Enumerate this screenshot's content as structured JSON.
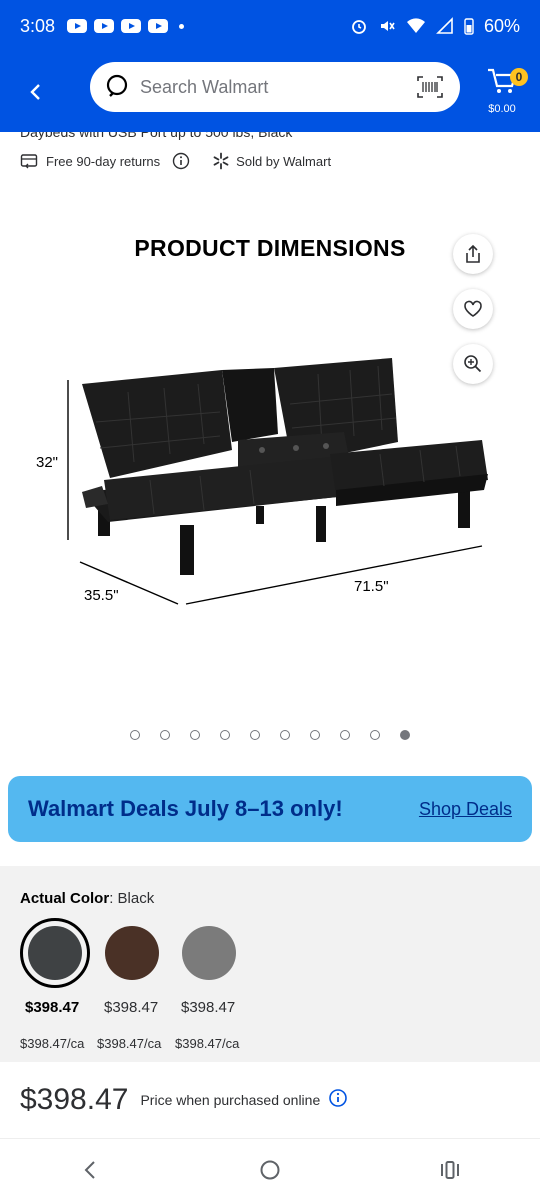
{
  "status": {
    "time": "3:08",
    "battery": "60%",
    "notification_icons": [
      "youtube-icon",
      "youtube-icon",
      "youtube-icon",
      "youtube-icon"
    ]
  },
  "header": {
    "search_placeholder": "Search Walmart",
    "cart_count": "0",
    "cart_amount": "$0.00"
  },
  "product": {
    "subtitle": "Daybeds with USB Port up to 500 lbs, Black",
    "returns": "Free 90-day returns",
    "sold_by": "Sold by Walmart",
    "image_title": "PRODUCT DIMENSIONS",
    "dim_height": "32\"",
    "dim_depth": "35.5\"",
    "dim_width": "71.5\"",
    "image_count": 10,
    "active_image": 10
  },
  "deals": {
    "headline": "Walmart Deals July 8–13 only!",
    "link": "Shop Deals"
  },
  "variants": {
    "label": "Actual Color",
    "selected": ": Black",
    "items": [
      {
        "color": "#3f4244",
        "price": "$398.47",
        "unit": "$398.47/ca"
      },
      {
        "color": "#4a3126",
        "price": "$398.47",
        "unit": "$398.47/ca"
      },
      {
        "color": "#7b7b7b",
        "price": "$398.47",
        "unit": "$398.47/ca"
      }
    ]
  },
  "price": {
    "amount": "$398.47",
    "note": "Price when purchased online"
  },
  "colors": {
    "brand_blue": "#0053e2",
    "deal_bg": "#54b8f0",
    "deal_text": "#002d8a",
    "cart_badge": "#ffc220"
  }
}
